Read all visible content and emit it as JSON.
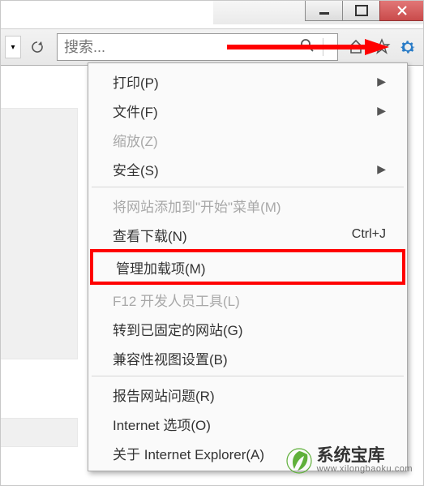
{
  "window": {
    "minimize": "minimize-button",
    "maximize": "maximize-button",
    "close": "close-button"
  },
  "toolbar": {
    "search_placeholder": "搜索..."
  },
  "menu": {
    "items": [
      {
        "label": "打印(P)",
        "submenu": true
      },
      {
        "label": "文件(F)",
        "submenu": true
      },
      {
        "label": "缩放(Z)",
        "disabled": true
      },
      {
        "label": "安全(S)",
        "submenu": true
      }
    ],
    "items2": [
      {
        "label": "将网站添加到\"开始\"菜单(M)",
        "disabled": true
      },
      {
        "label": "查看下载(N)",
        "shortcut": "Ctrl+J"
      },
      {
        "label": "管理加载项(M)",
        "highlighted": true
      },
      {
        "label": "F12 开发人员工具(L)",
        "disabled": true
      },
      {
        "label": "转到已固定的网站(G)"
      },
      {
        "label": "兼容性视图设置(B)"
      }
    ],
    "items3": [
      {
        "label": "报告网站问题(R)"
      },
      {
        "label": "Internet 选项(O)"
      },
      {
        "label": "关于 Internet Explorer(A)"
      }
    ]
  },
  "watermark": {
    "name": "系统宝库",
    "url": "www.xilongbaoku.com"
  }
}
